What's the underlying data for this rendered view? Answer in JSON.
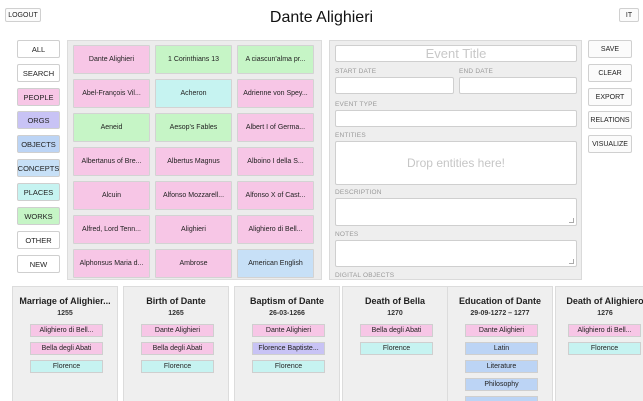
{
  "header": {
    "logout_label": "LOGOUT",
    "title": "Dante Alighieri",
    "language_label": "IT"
  },
  "filters": [
    {
      "label": "ALL",
      "color": "#ffffff"
    },
    {
      "label": "SEARCH",
      "color": "#ffffff"
    },
    {
      "label": "PEOPLE",
      "color": "#f7c6e6"
    },
    {
      "label": "ORGS",
      "color": "#c8c3f5"
    },
    {
      "label": "OBJECTS",
      "color": "#bcd4f5"
    },
    {
      "label": "CONCEPTS",
      "color": "#c7e0f7"
    },
    {
      "label": "PLACES",
      "color": "#c6f3f1"
    },
    {
      "label": "WORKS",
      "color": "#c6f5c6"
    },
    {
      "label": "OTHER",
      "color": "#ffffff"
    },
    {
      "label": "NEW",
      "color": "#ffffff"
    }
  ],
  "entities": [
    {
      "label": "Dante Alighieri",
      "color": "pink"
    },
    {
      "label": "1 Corinthians 13",
      "color": "green"
    },
    {
      "label": "A ciascun'alma pr...",
      "color": "green"
    },
    {
      "label": "Abel-François Vil...",
      "color": "pink"
    },
    {
      "label": "Acheron",
      "color": "cyan"
    },
    {
      "label": "Adrienne von Spey...",
      "color": "pink"
    },
    {
      "label": "Aeneid",
      "color": "green"
    },
    {
      "label": "Aesop's Fables",
      "color": "green"
    },
    {
      "label": "Albert I of Germa...",
      "color": "pink"
    },
    {
      "label": "Albertanus of Bre...",
      "color": "pink"
    },
    {
      "label": "Albertus Magnus",
      "color": "pink"
    },
    {
      "label": "Alboino I della S...",
      "color": "pink"
    },
    {
      "label": "Alcuin",
      "color": "pink"
    },
    {
      "label": "Alfonso Mozzarell...",
      "color": "pink"
    },
    {
      "label": "Alfonso X of Cast...",
      "color": "pink"
    },
    {
      "label": "Alfred, Lord Tenn...",
      "color": "pink"
    },
    {
      "label": "Alighieri",
      "color": "pink"
    },
    {
      "label": "Alighiero di Bell...",
      "color": "pink"
    },
    {
      "label": "Alphonsus Maria d...",
      "color": "pink"
    },
    {
      "label": "Ambrose",
      "color": "pink"
    },
    {
      "label": "American English",
      "color": "lightblue"
    }
  ],
  "form": {
    "title_placeholder": "Event Title",
    "start_date_label": "START DATE",
    "end_date_label": "END DATE",
    "event_type_label": "EVENT TYPE",
    "entities_label": "ENTITIES",
    "drop_text": "Drop entities here!",
    "description_label": "DESCRIPTION",
    "notes_label": "NOTES",
    "digital_objects_label": "DIGITAL OBJECTS"
  },
  "actions": [
    "SAVE",
    "CLEAR",
    "EXPORT",
    "RELATIONS",
    "VISUALIZE"
  ],
  "events": [
    {
      "title": "Marriage of Alighier...",
      "date": "1255",
      "tags": [
        {
          "label": "Alighiero di Bell...",
          "color": "pink"
        },
        {
          "label": "Bella degli Abati",
          "color": "pink"
        },
        {
          "label": "Florence",
          "color": "cyan"
        }
      ]
    },
    {
      "title": "Birth of Dante",
      "date": "1265",
      "tags": [
        {
          "label": "Dante Alighieri",
          "color": "pink"
        },
        {
          "label": "Bella degli Abati",
          "color": "pink"
        },
        {
          "label": "Florence",
          "color": "cyan"
        }
      ]
    },
    {
      "title": "Baptism of Dante",
      "date": "26-03-1266",
      "tags": [
        {
          "label": "Dante Alighieri",
          "color": "pink"
        },
        {
          "label": "Florence Baptiste...",
          "color": "lav"
        },
        {
          "label": "Florence",
          "color": "cyan"
        }
      ]
    },
    {
      "title": "Death of Bella",
      "date": "1270",
      "tags": [
        {
          "label": "Bella degli Abati",
          "color": "pink"
        },
        {
          "label": "Florence",
          "color": "cyan"
        }
      ]
    },
    {
      "title": "Education of Dante",
      "date": "29-09-1272 – 1277",
      "tags": [
        {
          "label": "Dante Alighieri",
          "color": "pink"
        },
        {
          "label": "Latin",
          "color": "blue"
        },
        {
          "label": "Literature",
          "color": "blue"
        },
        {
          "label": "Philosophy",
          "color": "blue"
        }
      ]
    },
    {
      "title": "Death of Alighiero",
      "date": "1276",
      "tags": [
        {
          "label": "Alighiero di Bell...",
          "color": "pink"
        },
        {
          "label": "Florence",
          "color": "cyan"
        }
      ]
    }
  ]
}
